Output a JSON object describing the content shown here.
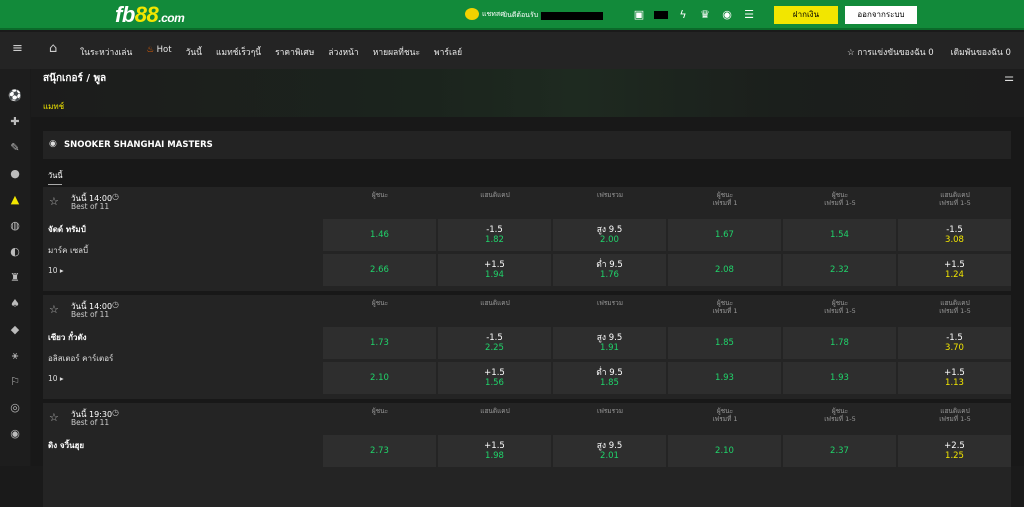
{
  "topbar": {
    "logo_main": "fb",
    "logo_num": "88",
    "logo_domain": ".com",
    "chat_label": "แชทสด",
    "balance_label": "ยินดีต้อนรับ",
    "deposit_label": "ฝากเงิน",
    "logout_label": "ออกจากระบบ"
  },
  "nav": {
    "items": [
      "ในระหว่างเล่น",
      "Hot",
      "วันนี้",
      "แมทช์เร็วๆนี้",
      "ราคาพิเศษ",
      "ล่วงหน้า",
      "หายผลที่ชนะ",
      "พาร์เลย์"
    ],
    "my_bets_label": "การแข่งขันของฉัน",
    "my_bets_count": "0",
    "betslip_label": "เดิมพันของฉัน",
    "betslip_count": "0"
  },
  "page": {
    "title": "สนุ๊กเกอร์ / พูล",
    "tab": "แมทช์",
    "competition": "SNOOKER SHANGHAI MASTERS",
    "day_label": "วันนี้"
  },
  "market_headers": [
    [
      "ผู้ชนะ"
    ],
    [
      "แฮนดิแคป"
    ],
    [
      "เฟรมรวม"
    ],
    [
      "ผู้ชนะ",
      "เฟรมที่ 1"
    ],
    [
      "ผู้ชนะ",
      "เฟรมที่ 1-5"
    ],
    [
      "แฮนดิแคป",
      "เฟรมที่ 1-5"
    ]
  ],
  "events": [
    {
      "time": "วันนี้ 14:00",
      "best_of": "Best of 11",
      "team1": "จัดด์ ทรัมป์",
      "team2": "มาร์ค เซลบี้",
      "more": "10",
      "rows": [
        [
          {
            "odd": "1.46"
          },
          {
            "line": "-1.5",
            "odd": "1.82"
          },
          {
            "line": "สูง 9.5",
            "odd": "2.00"
          },
          {
            "odd": "1.67"
          },
          {
            "odd": "1.54"
          },
          {
            "line": "-1.5",
            "odd": "3.08",
            "hl": true
          }
        ],
        [
          {
            "odd": "2.66"
          },
          {
            "line": "+1.5",
            "odd": "1.94"
          },
          {
            "line": "ต่ำ 9.5",
            "odd": "1.76"
          },
          {
            "odd": "2.08"
          },
          {
            "odd": "2.32"
          },
          {
            "line": "+1.5",
            "odd": "1.24",
            "hl": true
          }
        ]
      ]
    },
    {
      "time": "วันนี้ 14:00",
      "best_of": "Best of 11",
      "team1": "เซียว กั๋วตัง",
      "team2": "อลิสเตอร์ คาร์เตอร์",
      "more": "10",
      "rows": [
        [
          {
            "odd": "1.73"
          },
          {
            "line": "-1.5",
            "odd": "2.25"
          },
          {
            "line": "สูง 9.5",
            "odd": "1.91"
          },
          {
            "odd": "1.85"
          },
          {
            "odd": "1.78"
          },
          {
            "line": "-1.5",
            "odd": "3.70",
            "hl": true
          }
        ],
        [
          {
            "odd": "2.10"
          },
          {
            "line": "+1.5",
            "odd": "1.56"
          },
          {
            "line": "ต่ำ 9.5",
            "odd": "1.85"
          },
          {
            "odd": "1.93"
          },
          {
            "odd": "1.93"
          },
          {
            "line": "+1.5",
            "odd": "1.13",
            "hl": true
          }
        ]
      ]
    },
    {
      "time": "วันนี้ 19:30",
      "best_of": "Best of 11",
      "team1": "ดิง จวิ้นฮุย",
      "team2": "",
      "more": "",
      "rows": [
        [
          {
            "odd": "2.73"
          },
          {
            "line": "+1.5",
            "odd": "1.98"
          },
          {
            "line": "สูง 9.5",
            "odd": "2.01"
          },
          {
            "odd": "2.10"
          },
          {
            "odd": "2.37"
          },
          {
            "line": "+2.5",
            "odd": "1.25",
            "hl": true
          }
        ]
      ]
    }
  ]
}
